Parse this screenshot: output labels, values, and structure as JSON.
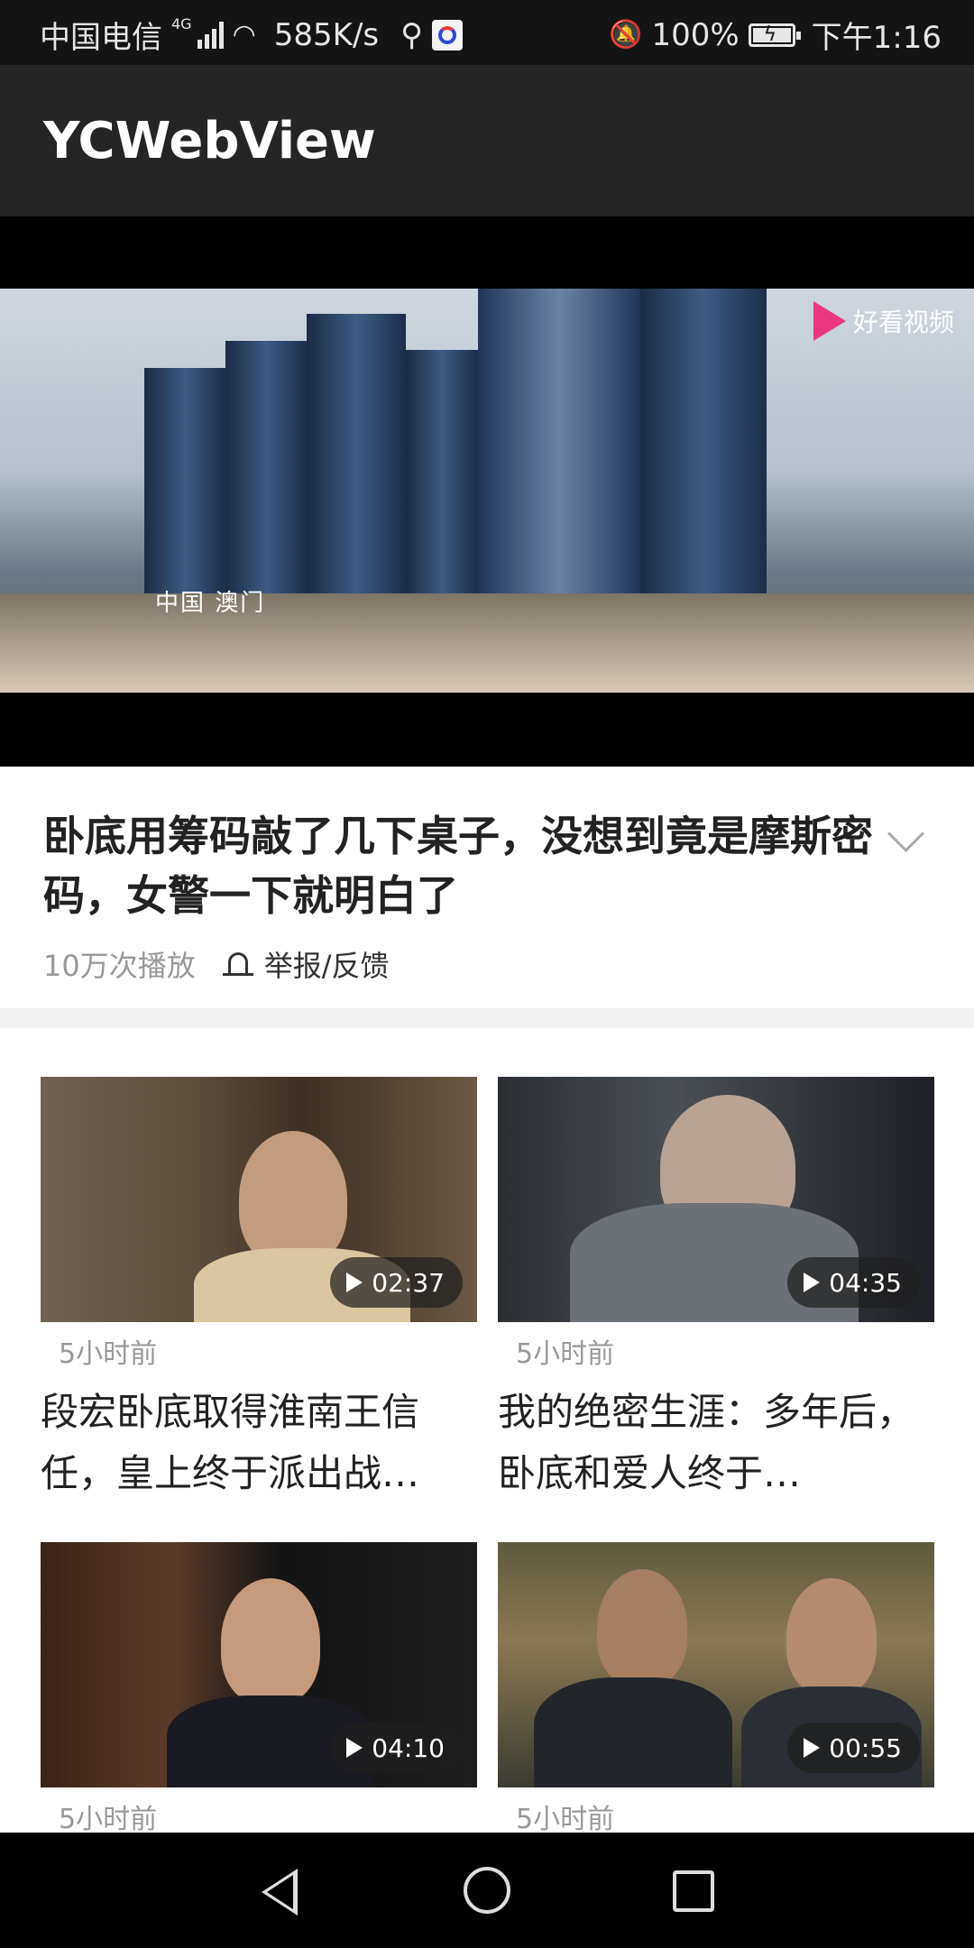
{
  "status_bar": {
    "carrier": "中国电信",
    "network": "4G",
    "speed": "585K/s",
    "battery": "100%",
    "time": "下午1:16"
  },
  "app": {
    "title": "YCWebView"
  },
  "player": {
    "caption": "中国  澳门",
    "watermark": "好看视频"
  },
  "video": {
    "title": "卧底用筹码敲了几下桌子，没想到竟是摩斯密码，女警一下就明白了",
    "views": "10万次播放",
    "report": "举报/反馈"
  },
  "related": [
    {
      "duration": "02:37",
      "time": "5小时前",
      "title": "段宏卧底取得淮南王信任，皇上终于派出战…"
    },
    {
      "duration": "04:35",
      "time": "5小时前",
      "title": "我的绝密生涯：多年后，卧底和爱人终于…"
    },
    {
      "duration": "04:10",
      "time": "5小时前",
      "title": ""
    },
    {
      "duration": "00:55",
      "time": "5小时前",
      "title": ""
    }
  ],
  "icons": [
    "signal-icon",
    "wifi-icon",
    "usb-icon",
    "app-badge-icon",
    "mute-icon",
    "battery-icon",
    "chevron-down-icon",
    "report-icon",
    "play-icon",
    "back-icon",
    "home-icon",
    "recents-icon"
  ]
}
